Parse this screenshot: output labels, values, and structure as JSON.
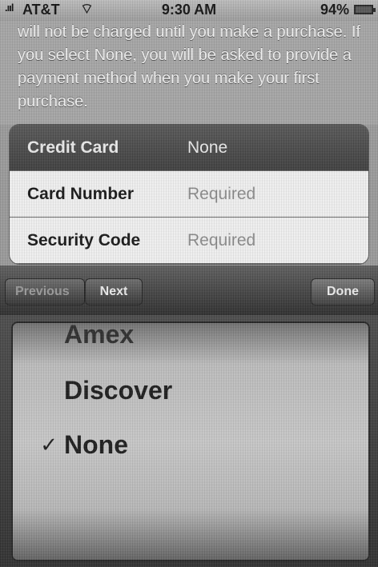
{
  "status_bar": {
    "carrier": "AT&T",
    "time": "9:30 AM",
    "battery": "94%"
  },
  "intro_text": "will not be charged until you make a purchase. If you select None, you will be asked to provide a payment method when you make your first purchase.",
  "form": {
    "rows": [
      {
        "label": "Credit Card",
        "value": "None"
      },
      {
        "label": "Card Number",
        "value": "Required"
      },
      {
        "label": "Security Code",
        "value": "Required"
      }
    ]
  },
  "toolbar": {
    "previous": "Previous",
    "next": "Next",
    "done": "Done"
  },
  "picker": {
    "options": [
      "Amex",
      "Discover",
      "None"
    ],
    "selected": "None",
    "check": "✓"
  }
}
